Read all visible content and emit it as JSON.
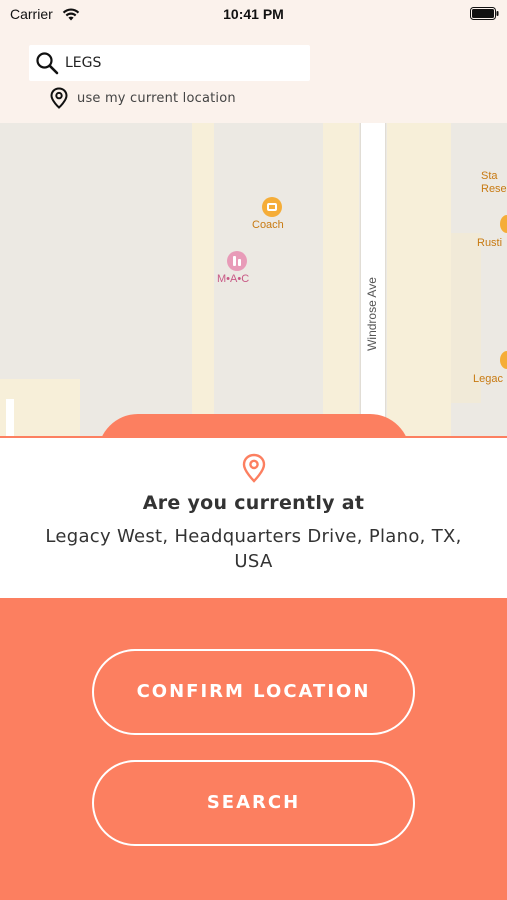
{
  "status_bar": {
    "carrier": "Carrier",
    "time": "10:41 PM"
  },
  "search": {
    "value": "LEGS",
    "current_location_label": "use my current location"
  },
  "map": {
    "street_label": "Windrose Ave",
    "pois": {
      "coach": "Coach",
      "mac": "M•A•C",
      "right_top": "Sta\nRese",
      "right_mid": "Rusti",
      "right_low": "Legac"
    }
  },
  "location_card": {
    "question": "Are you currently at",
    "address": "Legacy West, Headquarters Drive, Plano, TX, USA"
  },
  "actions": {
    "confirm_label": "CONFIRM LOCATION",
    "search_label": "SEARCH"
  },
  "colors": {
    "accent": "#fc7f60",
    "header_bg": "#fbf2ec",
    "map_bg": "#ece9e3",
    "map_block": "#f7efd9"
  },
  "icons": {
    "search": "search-icon",
    "pin": "pin-icon",
    "wifi": "wifi-icon",
    "battery": "battery-icon"
  }
}
